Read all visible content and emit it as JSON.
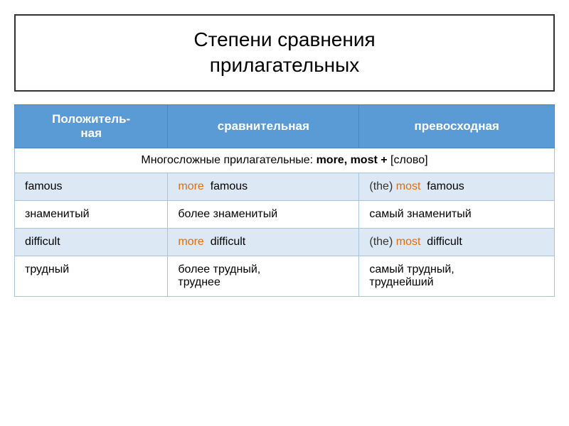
{
  "title": {
    "line1": "Степени сравнения",
    "line2": "прилагательных"
  },
  "table": {
    "headers": [
      "Положитель-\nная",
      "сравнительная",
      "превосходная"
    ],
    "subheader": {
      "text_before_bold": "Многосложные прилагательные: ",
      "bold_text": "more, most +",
      "text_after": " [слово]"
    },
    "rows": [
      {
        "col1": "famous",
        "col2_prefix": "",
        "col2_orange": "more",
        "col2_suffix": "famous",
        "col3_prefix": "(the)",
        "col3_orange": "most",
        "col3_suffix": "famous"
      },
      {
        "col1": "знаменитый",
        "col2_plain": "более знаменитый",
        "col3_plain": "самый знаменитый"
      },
      {
        "col1": "difficult",
        "col2_prefix": "",
        "col2_orange": "more",
        "col2_suffix": "difficult",
        "col3_prefix": "(the)",
        "col3_orange": "most",
        "col3_suffix": "difficult"
      },
      {
        "col1": "трудный",
        "col2_plain": "более трудный,\nтруднее",
        "col3_plain": "самый трудный,\nтруднейший"
      }
    ]
  }
}
